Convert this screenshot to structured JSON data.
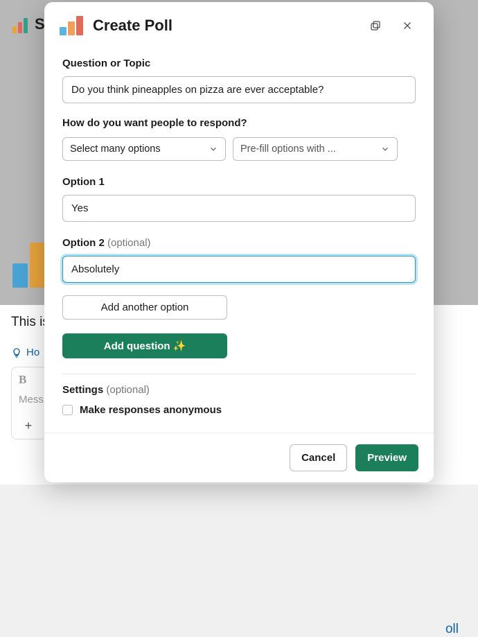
{
  "background": {
    "app_initial": "Si",
    "this_line": "This is",
    "hint_label": "Ho",
    "compose_bold": "B",
    "compose_placeholder": "Mess",
    "compose_plus": "+",
    "poll_link": "oll"
  },
  "modal": {
    "title": "Create Poll",
    "question_label": "Question or Topic",
    "question_value": "Do you think pineapples on pizza are ever acceptable?",
    "respond_label": "How do you want people to respond?",
    "select_mode": "Select many options",
    "prefill": "Pre-fill options with ...",
    "option1_label": "Option 1",
    "option1_value": "Yes",
    "option2_label": "Option 2",
    "option2_optional": "(optional)",
    "option2_value": "Absolutely",
    "add_option": "Add another option",
    "add_question": "Add question",
    "add_question_sparkle": "✨",
    "settings_label": "Settings",
    "settings_optional": "(optional)",
    "anon_label": "Make responses anonymous",
    "cancel": "Cancel",
    "preview": "Preview"
  }
}
